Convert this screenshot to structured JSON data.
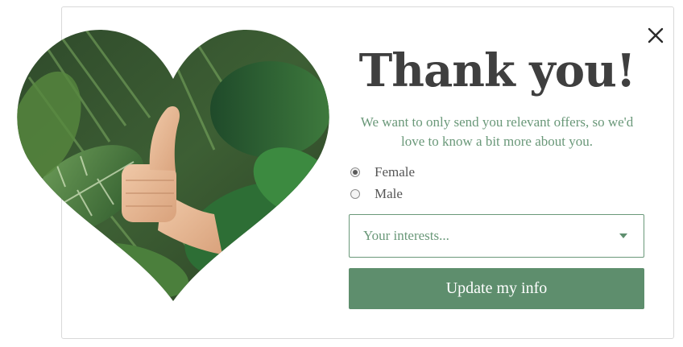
{
  "popup": {
    "title": "Thank you!",
    "subtitle": "We want to only send you relevant offers, so we'd love to know a bit more about you.",
    "close_icon": "close-icon",
    "image": "heart-shaped photo of a thumbs-up hand among tropical leaves"
  },
  "gender": {
    "options": [
      {
        "label": "Female",
        "selected": true
      },
      {
        "label": "Male",
        "selected": false
      }
    ]
  },
  "interests": {
    "placeholder": "Your interests...",
    "icon": "chevron-down-icon"
  },
  "submit": {
    "label": "Update my info"
  },
  "colors": {
    "accent": "#5e8e6d",
    "accent_text": "#6a9879",
    "title": "#3f3f3f"
  }
}
